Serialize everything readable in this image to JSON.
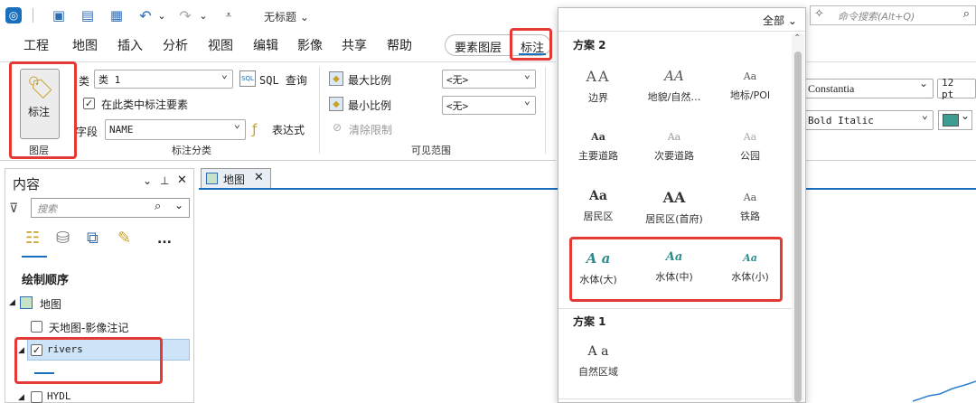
{
  "title_bar": {
    "doc_title": "无标题"
  },
  "search": {
    "scope": "全部",
    "placeholder": "命令搜索(Alt+Q)"
  },
  "ribbon_tabs": [
    {
      "label": "工程"
    },
    {
      "label": "地图"
    },
    {
      "label": "插入"
    },
    {
      "label": "分析"
    },
    {
      "label": "视图"
    },
    {
      "label": "编辑"
    },
    {
      "label": "影像"
    },
    {
      "label": "共享"
    },
    {
      "label": "帮助"
    },
    {
      "label": "要素图层"
    },
    {
      "label": "标注"
    }
  ],
  "layer_group": {
    "button_label": "标注",
    "group_label": "图层"
  },
  "label_class": {
    "class_label": "类",
    "class_value": "类 1",
    "sql_label": "SQL 查询",
    "checkbox_label": "在此类中标注要素",
    "field_label": "字段",
    "field_value": "NAME",
    "expression_label": "表达式",
    "group_label": "标注分类"
  },
  "visible_range": {
    "max_scale_label": "最大比例",
    "max_scale_value": "<无>",
    "min_scale_label": "最小比例",
    "min_scale_value": "<无>",
    "clear_label": "清除限制",
    "group_label": "可见范围"
  },
  "text_symbol": {
    "font_family": "Constantia",
    "font_size": "12 pt",
    "font_style": "Bold Italic",
    "swatch_color": "#3d9d93"
  },
  "contents": {
    "title": "内容",
    "search_placeholder": "搜索",
    "more": "...",
    "draw_order": "绘制顺序",
    "layers": [
      {
        "label": "地图"
      },
      {
        "label": "天地图-影像注记"
      },
      {
        "label": "rivers"
      },
      {
        "label": "HYDL"
      }
    ]
  },
  "map_tab": {
    "label": "地图"
  },
  "gallery": {
    "sections": [
      {
        "title": "方案 2",
        "items": [
          {
            "sample": "AA",
            "label": "边界"
          },
          {
            "sample": "AA",
            "label": "地貌/自然…"
          },
          {
            "sample": "Aa",
            "label": "地标/POI"
          },
          {
            "sample": "Aa",
            "label": "主要道路"
          },
          {
            "sample": "Aa",
            "label": "次要道路"
          },
          {
            "sample": "Aa",
            "label": "公园"
          },
          {
            "sample": "Aa",
            "label": "居民区"
          },
          {
            "sample": "AA",
            "label": "居民区(首府)"
          },
          {
            "sample": "Aa",
            "label": "铁路"
          },
          {
            "sample": "A a",
            "label": "水体(大)"
          },
          {
            "sample": "Aa",
            "label": "水体(中)"
          },
          {
            "sample": "Aa",
            "label": "水体(小)"
          }
        ]
      },
      {
        "title": "方案 1",
        "items": [
          {
            "sample": "A a",
            "label": "自然区域"
          }
        ]
      }
    ]
  },
  "colors": {
    "accent": "#1a6fbd",
    "highlight_red": "#e53935",
    "water_text": "#2e8b8b"
  }
}
